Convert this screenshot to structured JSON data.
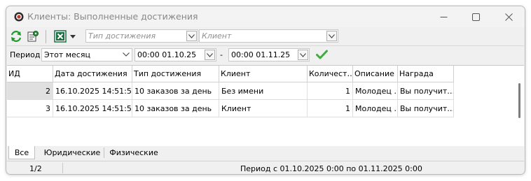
{
  "window": {
    "title": "Клиенты: Выполненные достижения"
  },
  "toolbar": {
    "achievement_type_placeholder": "Тип достижения",
    "client_placeholder": "Клиент"
  },
  "filter": {
    "period_label": "Период",
    "period_value": "Этот месяц",
    "date_from": "00:00 01.10.25",
    "dash": "-",
    "date_to": "00:00 01.11.25"
  },
  "table": {
    "columns": [
      "ИД",
      "Дата достижения",
      "Тип достижения",
      "Клиент",
      "Количест…",
      "Описание",
      "Награда"
    ],
    "rows": [
      {
        "id": "2",
        "date": "16.10.2025 14:51:55",
        "type": "10 заказов за день",
        "client": "Без имени",
        "count": "1",
        "description": "Молодец …",
        "reward": "Вы получит…"
      },
      {
        "id": "3",
        "date": "16.10.2025 14:51:55",
        "type": "10 заказов за день",
        "client": "Клиент",
        "count": "1",
        "description": "Молодец …",
        "reward": "Вы получит…"
      }
    ]
  },
  "tabs": [
    "Все",
    "Юридические",
    "Физические"
  ],
  "status": {
    "counter": "1/2",
    "period_text": "Период с 01.10.2025 0:00 по 01.11.2025 0:00"
  },
  "colors": {
    "selected_id_cell": "#e0e0e0",
    "apply_check": "#3cae3c",
    "app_icon": "#c0392b"
  },
  "icons": [
    "app-icon",
    "refresh-icon",
    "settings-icon",
    "excel-icon",
    "dropdown-arrow-icon",
    "minimize-icon",
    "maximize-icon",
    "close-icon",
    "checkmark-icon"
  ]
}
